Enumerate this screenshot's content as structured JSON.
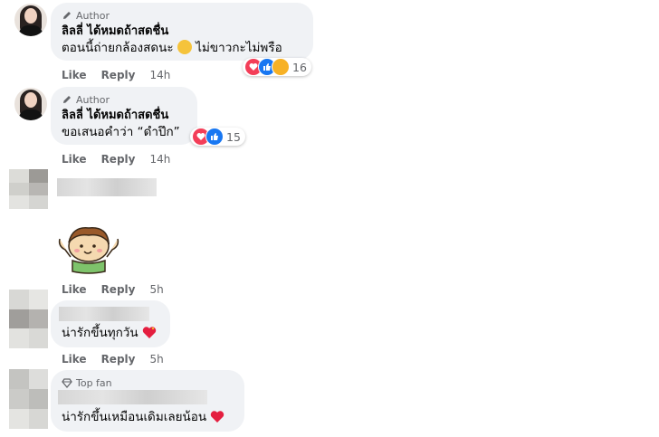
{
  "comments": [
    {
      "badge": "Author",
      "name": "ลิลลี่ ได้หมดถ้าสดชื่น",
      "text": "ตอนนี้ถ่ายกล้องสดนะ",
      "text_after_emoji": "ไม่ขาวกะไม่พรือ",
      "reaction_count": "16",
      "like": "Like",
      "reply": "Reply",
      "time": "14h"
    },
    {
      "badge": "Author",
      "name": "ลิลลี่ ได้หมดถ้าสดชื่น",
      "text": "ขอเสนอคำว่า “ดำปึก”",
      "reaction_count": "15",
      "like": "Like",
      "reply": "Reply",
      "time": "14h"
    },
    {
      "sticker": "cartoon-boy-sticker",
      "like": "Like",
      "reply": "Reply",
      "time": "5h"
    },
    {
      "text": "น่ารักขึ้นทุกวัน",
      "like": "Like",
      "reply": "Reply",
      "time": "5h"
    },
    {
      "badge": "Top fan",
      "text": "น่ารักขึ้นเหมือนเดิมเลยน้อน"
    }
  ],
  "colors": {
    "bubble": "#f0f2f5",
    "meta": "#65676b",
    "love": "#f33e58",
    "like": "#1877f2",
    "heart": "#e41e3f"
  }
}
